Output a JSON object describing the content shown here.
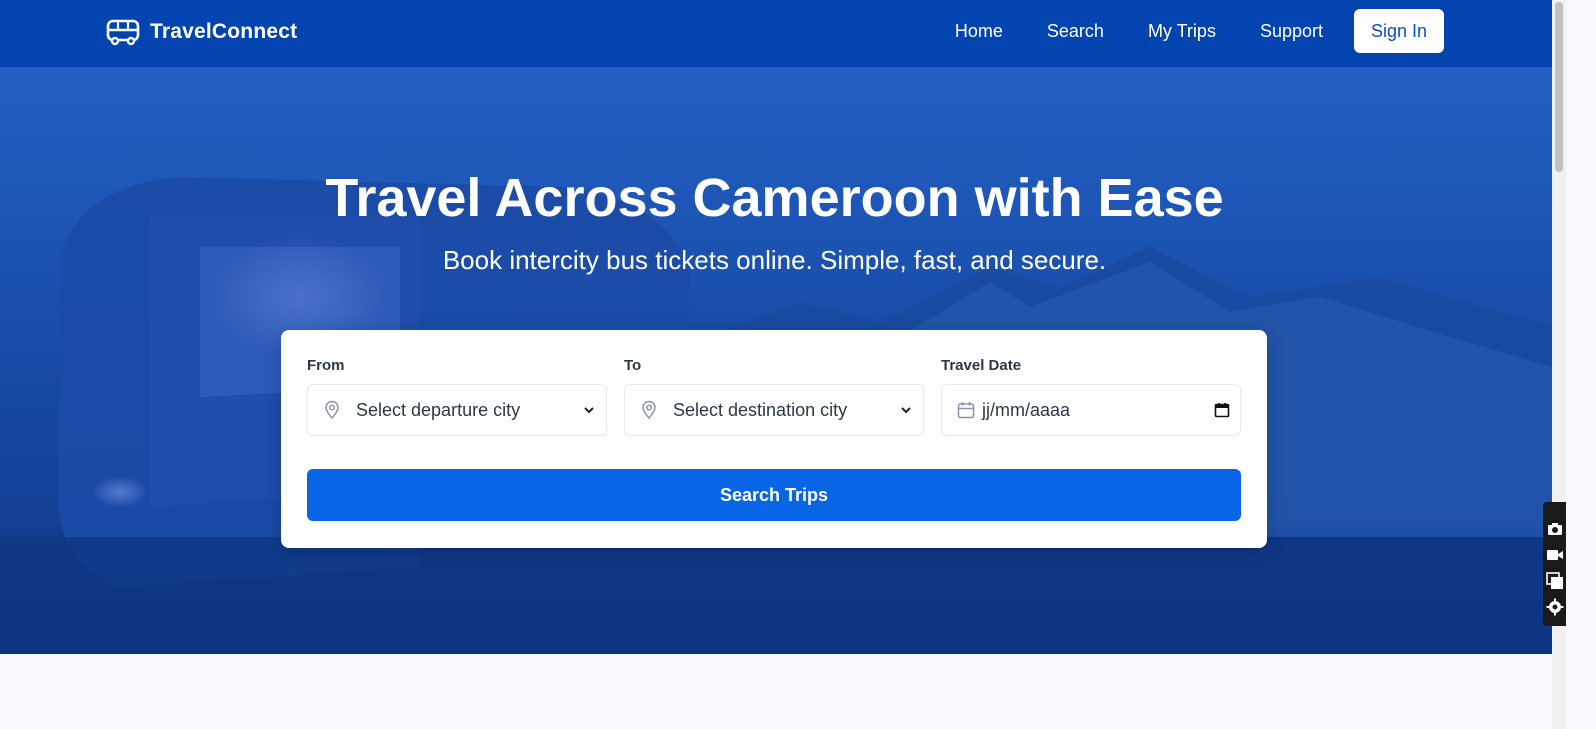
{
  "brand": {
    "name": "TravelConnect",
    "icon": "bus-icon"
  },
  "nav": {
    "links": [
      "Home",
      "Search",
      "My Trips",
      "Support"
    ],
    "signin_label": "Sign In"
  },
  "hero": {
    "title": "Travel Across Cameroon with Ease",
    "subtitle": "Book intercity bus tickets online. Simple, fast, and secure."
  },
  "search_form": {
    "from": {
      "label": "From",
      "value": "Select departure city",
      "icon": "map-pin-icon"
    },
    "to": {
      "label": "To",
      "value": "Select destination city",
      "icon": "map-pin-icon"
    },
    "date": {
      "label": "Travel Date",
      "value": "jj/mm/aaaa",
      "icon": "calendar-icon"
    },
    "submit_label": "Search Trips"
  },
  "colors": {
    "navbar": "#0444b0",
    "primary_button": "#0866e6",
    "hero_overlay": "#1549a6"
  },
  "side_tools": [
    "camera-icon",
    "video-icon",
    "window-icon",
    "gear-icon"
  ]
}
